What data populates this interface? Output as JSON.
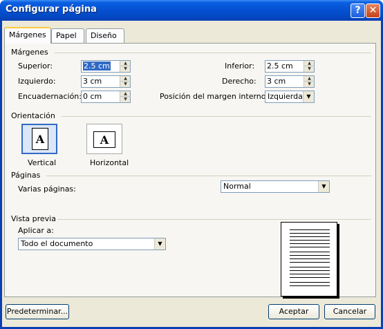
{
  "window": {
    "title": "Configurar página",
    "help_glyph": "?",
    "close_glyph": "✕"
  },
  "tabs": [
    {
      "label": "Márgenes",
      "active": true
    },
    {
      "label": "Papel",
      "active": false
    },
    {
      "label": "Diseño",
      "active": false
    }
  ],
  "margins": {
    "section_label": "Márgenes",
    "superior": {
      "label": "Superior:",
      "value": "2.5 cm"
    },
    "izquierdo": {
      "label": "Izquierdo:",
      "value": "3 cm"
    },
    "encuadernacion": {
      "label": "Encuadernación:",
      "value": "0 cm"
    },
    "inferior": {
      "label": "Inferior:",
      "value": "2.5 cm"
    },
    "derecho": {
      "label": "Derecho:",
      "value": "3 cm"
    },
    "posicion": {
      "label": "Posición del margen interno:",
      "value": "Izquierda"
    }
  },
  "orientation": {
    "section_label": "Orientación",
    "vertical": {
      "label": "Vertical",
      "glyph": "A",
      "selected": true
    },
    "horizontal": {
      "label": "Horizontal",
      "glyph": "A",
      "selected": false
    }
  },
  "pages": {
    "section_label": "Páginas",
    "multiple_label": "Varias páginas:",
    "multiple_value": "Normal"
  },
  "preview": {
    "section_label": "Vista previa",
    "apply_label": "Aplicar a:",
    "apply_value": "Todo el documento"
  },
  "buttons": {
    "default": "Predeterminar...",
    "ok": "Aceptar",
    "cancel": "Cancelar"
  },
  "colors": {
    "titlebar": "#0552d4",
    "selection": "#316ac5",
    "dialog_bg": "#ece9d8"
  }
}
